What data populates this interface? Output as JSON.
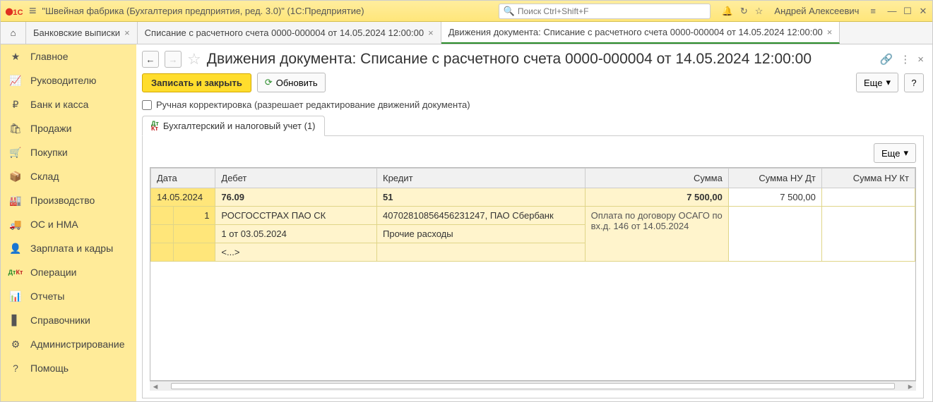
{
  "top": {
    "app_title": "\"Швейная фабрика (Бухгалтерия предприятия, ред. 3.0)\"  (1С:Предприятие)",
    "search_placeholder": "Поиск Ctrl+Shift+F",
    "username": "Андрей Алексеевич"
  },
  "tabs": [
    {
      "label": "Банковские выписки"
    },
    {
      "label": "Списание с расчетного счета 0000-000004 от 14.05.2024 12:00:00"
    },
    {
      "label": "Движения документа: Списание с расчетного счета 0000-000004 от 14.05.2024 12:00:00",
      "active": true
    }
  ],
  "sidebar": [
    "Главное",
    "Руководителю",
    "Банк и касса",
    "Продажи",
    "Покупки",
    "Склад",
    "Производство",
    "ОС и НМА",
    "Зарплата и кадры",
    "Операции",
    "Отчеты",
    "Справочники",
    "Администрирование",
    "Помощь"
  ],
  "page": {
    "title": "Движения документа: Списание с расчетного счета 0000-000004 от 14.05.2024 12:00:00",
    "save_close": "Записать и закрыть",
    "refresh": "Обновить",
    "more": "Еще",
    "help": "?",
    "manual_edit": "Ручная корректировка (разрешает редактирование движений документа)",
    "inner_tab": "Бухгалтерский и налоговый учет (1)"
  },
  "table": {
    "headers": {
      "date": "Дата",
      "debit": "Дебет",
      "credit": "Кредит",
      "amount": "Сумма",
      "nu_dt": "Сумма НУ Дт",
      "nu_kt": "Сумма НУ Кт"
    },
    "row": {
      "date": "14.05.2024",
      "num": "1",
      "debit_acc": "76.09",
      "debit1": "РОСГОССТРАХ ПАО СК",
      "debit2": "1 от 03.05.2024",
      "debit3": "<...>",
      "credit_acc": "51",
      "credit1": "40702810856456231247, ПАО Сбербанк",
      "credit2": "Прочие расходы",
      "amount": "7 500,00",
      "amount_desc": "Оплата по договору ОСАГО по вх.д. 146 от 14.05.2024",
      "nu_dt": "7 500,00"
    }
  }
}
